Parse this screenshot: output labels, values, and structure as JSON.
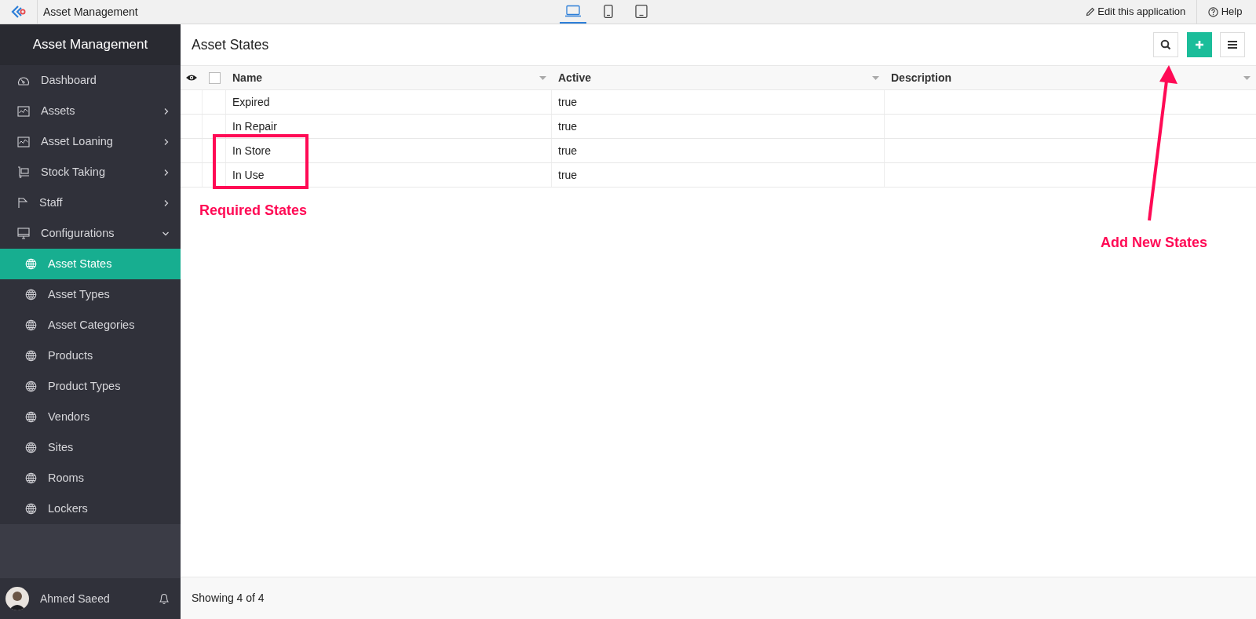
{
  "topbar": {
    "app_name": "Asset Management",
    "device_tabs": [
      {
        "selected": true
      },
      {
        "selected": false
      },
      {
        "selected": false
      }
    ],
    "edit_link": "Edit this application",
    "help_link": "Help"
  },
  "sidebar": {
    "title": "Asset Management",
    "items": [
      {
        "label": "Dashboard"
      },
      {
        "label": "Assets",
        "expanded": false
      },
      {
        "label": "Asset Loaning",
        "expanded": false
      },
      {
        "label": "Stock Taking",
        "expanded": false
      },
      {
        "label": "Staff",
        "expanded": false
      },
      {
        "label": "Configurations",
        "expanded": true,
        "children": [
          {
            "label": "Asset States",
            "selected": true
          },
          {
            "label": "Asset Types",
            "selected": false
          },
          {
            "label": "Asset Categories",
            "selected": false
          },
          {
            "label": "Products",
            "selected": false
          },
          {
            "label": "Product Types",
            "selected": false
          },
          {
            "label": "Vendors",
            "selected": false
          },
          {
            "label": "Sites",
            "selected": false
          },
          {
            "label": "Rooms",
            "selected": false
          },
          {
            "label": "Lockers",
            "selected": false
          }
        ]
      }
    ],
    "user": "Ahmed Saeed"
  },
  "page": {
    "title": "Asset States"
  },
  "table": {
    "select_all": {
      "checked": false
    },
    "columns": [
      "Name",
      "Active",
      "Description"
    ],
    "rows": [
      {
        "name": "Expired",
        "active": "true"
      },
      {
        "name": "In Repair",
        "active": "true"
      },
      {
        "name": "In Store",
        "active": "true"
      },
      {
        "name": "In Use",
        "active": "true"
      }
    ]
  },
  "footer": "Showing 4 of 4",
  "annotations": {
    "highlight_label": "Required States",
    "arrow_label": "Add New States"
  }
}
